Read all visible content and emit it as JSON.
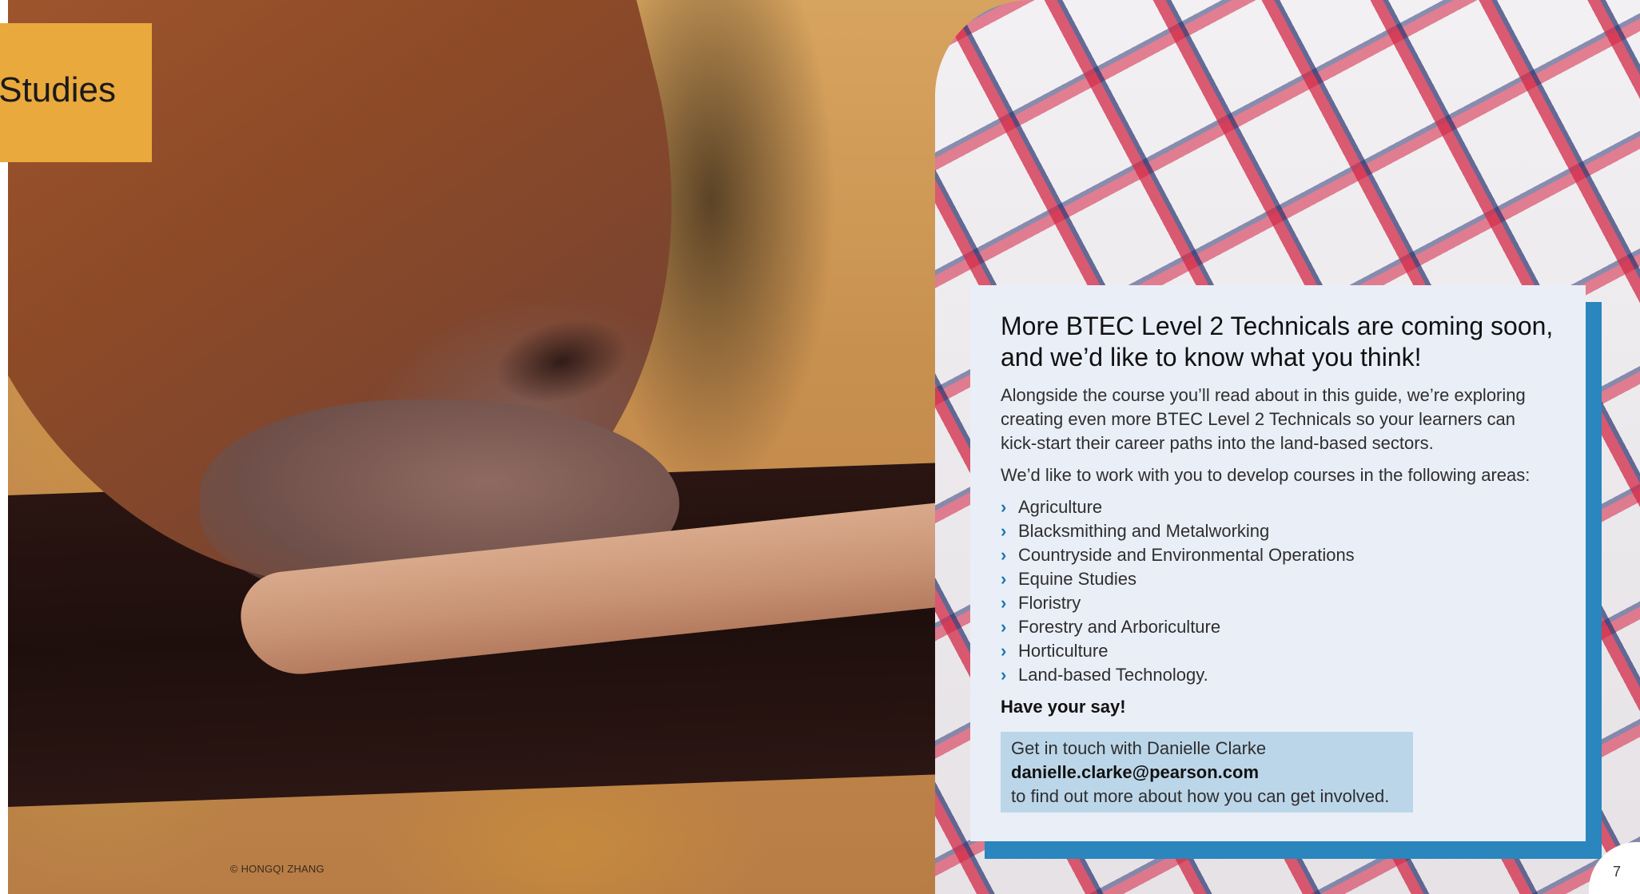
{
  "title_tab": {
    "text": "Studies",
    "color": "#eaa93c"
  },
  "photo": {
    "credit": "© HONGQI ZHANG"
  },
  "info_box": {
    "heading": "More BTEC Level 2 Technicals are coming soon, and we’d like to know what you think!",
    "intro": "Alongside the course you’ll read about in this guide, we’re exploring creating even more BTEC Level 2 Technicals so your learners can kick-start their career paths into the land-based sectors.",
    "lead": "We’d like to work with you to develop courses in the following areas:",
    "areas": [
      "Agriculture",
      "Blacksmithing and Metalworking",
      "Countryside and Environmental Operations",
      "Equine Studies",
      "Floristry",
      "Forestry and Arboriculture",
      "Horticulture",
      "Land-based Technology."
    ],
    "bullet_icon": "chevron-right-icon",
    "call_to_action": "Have your say!",
    "contact": {
      "line1": "Get in touch with Danielle Clarke",
      "email": "danielle.clarke@pearson.com",
      "line3": "to find out more about how you can get involved."
    },
    "colors": {
      "box_background": "#eaeef7",
      "shadow": "#2a86bd",
      "contact_background": "#bcd6e9",
      "bullet": "#1f77b4"
    }
  },
  "page_number": "7"
}
